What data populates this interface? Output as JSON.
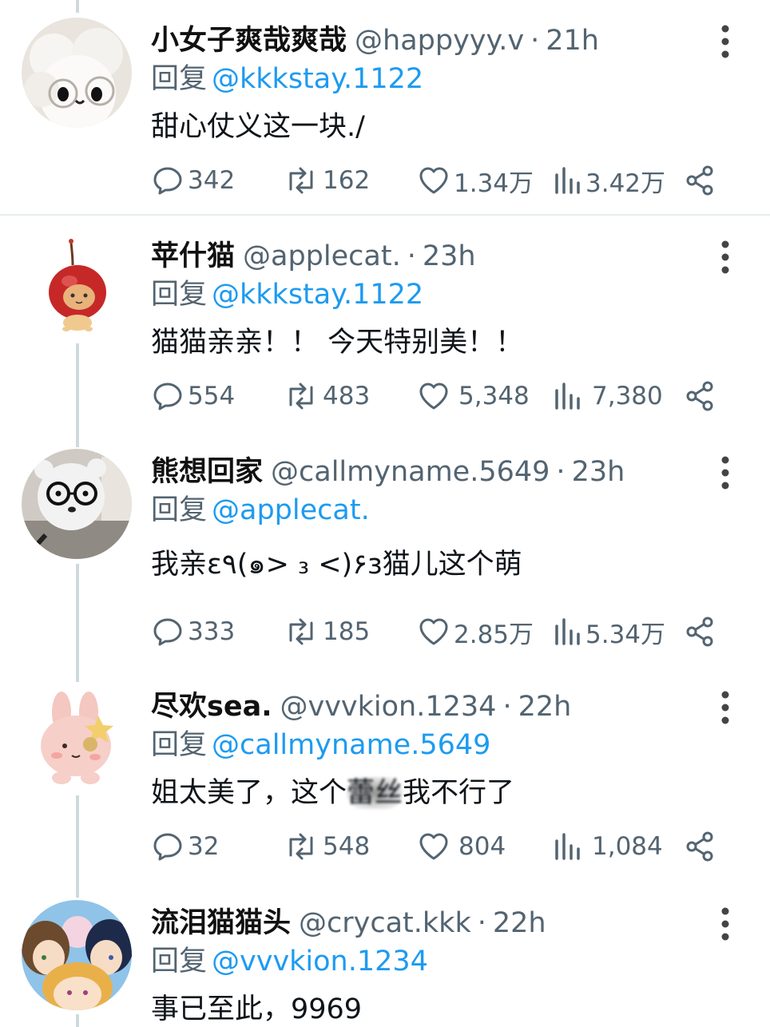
{
  "posts": [
    {
      "name": "小女子爽哉爽哉",
      "handle": "@happyyy.v",
      "dot": "·",
      "time": "21h",
      "reply_word": "回复",
      "reply_to": "@kkkstay.1122",
      "content": "甜心仗义这一块./",
      "replies": "342",
      "retweets": "162",
      "likes": "1.34万",
      "views": "3.42万",
      "avatar_icon": "fluffy-sheep-glasses-icon"
    },
    {
      "name": "苹什猫",
      "handle": "@applecat.",
      "dot": "·",
      "time": "23h",
      "reply_word": "回复",
      "reply_to": "@kkkstay.1122",
      "content": "猫猫亲亲！！ 今天特别美！！",
      "replies": "554",
      "retweets": "483",
      "likes": "5,348",
      "views": "7,380",
      "avatar_icon": "cherry-cat-icon"
    },
    {
      "name": "熊想回家",
      "handle": "@callmyname.5649",
      "dot": "·",
      "time": "23h",
      "reply_word": "回复",
      "reply_to": "@applecat.",
      "content": "我亲ε٩(๑> ₃ <)۶з猫儿这个萌",
      "replies": "333",
      "retweets": "185",
      "likes": "2.85万",
      "views": "5.34万",
      "avatar_icon": "plush-bear-glasses-icon"
    },
    {
      "name": "尽欢sea.",
      "handle": "@vvvkion.1234",
      "dot": "·",
      "time": "22h",
      "reply_word": "回复",
      "reply_to": "@callmyname.5649",
      "content_before": "姐太美了，这个",
      "content_blurred": "蕾丝",
      "content_after": "我不行了",
      "replies": "32",
      "retweets": "548",
      "likes": "804",
      "views": "1,084",
      "avatar_icon": "pink-bunny-plush-icon"
    },
    {
      "name": "流泪猫猫头",
      "handle": "@crycat.kkk",
      "dot": "·",
      "time": "22h",
      "reply_word": "回复",
      "reply_to": "@vvvkion.1234",
      "content": "事已至此，9969",
      "avatar_icon": "anime-characters-icon"
    }
  ],
  "colors": {
    "accent": "#1d9bf0",
    "secondary_text": "#536471",
    "thread_line": "#cfd9de"
  }
}
